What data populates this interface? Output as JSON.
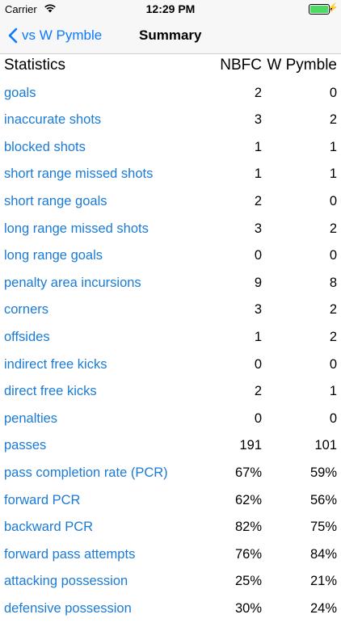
{
  "status_bar": {
    "carrier": "Carrier",
    "time": "12:29 PM"
  },
  "nav": {
    "back_label": "vs W Pymble",
    "title": "Summary"
  },
  "table": {
    "header": {
      "label": "Statistics",
      "team1": "NBFC",
      "team2": "W Pymble"
    },
    "rows": [
      {
        "label": "goals",
        "v1": "2",
        "v2": "0"
      },
      {
        "label": "inaccurate shots",
        "v1": "3",
        "v2": "2"
      },
      {
        "label": "blocked shots",
        "v1": "1",
        "v2": "1"
      },
      {
        "label": "short range missed shots",
        "v1": "1",
        "v2": "1"
      },
      {
        "label": "short range goals",
        "v1": "2",
        "v2": "0"
      },
      {
        "label": "long range missed shots",
        "v1": "3",
        "v2": "2"
      },
      {
        "label": "long range goals",
        "v1": "0",
        "v2": "0"
      },
      {
        "label": "penalty area incursions",
        "v1": "9",
        "v2": "8"
      },
      {
        "label": "corners",
        "v1": "3",
        "v2": "2"
      },
      {
        "label": "offsides",
        "v1": "1",
        "v2": "2"
      },
      {
        "label": "indirect free kicks",
        "v1": "0",
        "v2": "0"
      },
      {
        "label": "direct free kicks",
        "v1": "2",
        "v2": "1"
      },
      {
        "label": "penalties",
        "v1": "0",
        "v2": "0"
      },
      {
        "label": "passes",
        "v1": "191",
        "v2": "101"
      },
      {
        "label": "pass completion rate (PCR)",
        "v1": "67%",
        "v2": "59%"
      },
      {
        "label": "forward PCR",
        "v1": "62%",
        "v2": "56%"
      },
      {
        "label": "backward PCR",
        "v1": "82%",
        "v2": "75%"
      },
      {
        "label": "forward pass attempts",
        "v1": "76%",
        "v2": "84%"
      },
      {
        "label": "attacking possession",
        "v1": "25%",
        "v2": "21%"
      },
      {
        "label": "defensive possession",
        "v1": "30%",
        "v2": "24%"
      }
    ]
  },
  "colors": {
    "link": "#1a7bd5",
    "nav_tint": "#0a7aff",
    "battery": "#4cd964"
  },
  "icons": {
    "back": "chevron-left-icon",
    "wifi": "wifi-icon",
    "battery": "battery-icon",
    "charging": "bolt-icon"
  }
}
